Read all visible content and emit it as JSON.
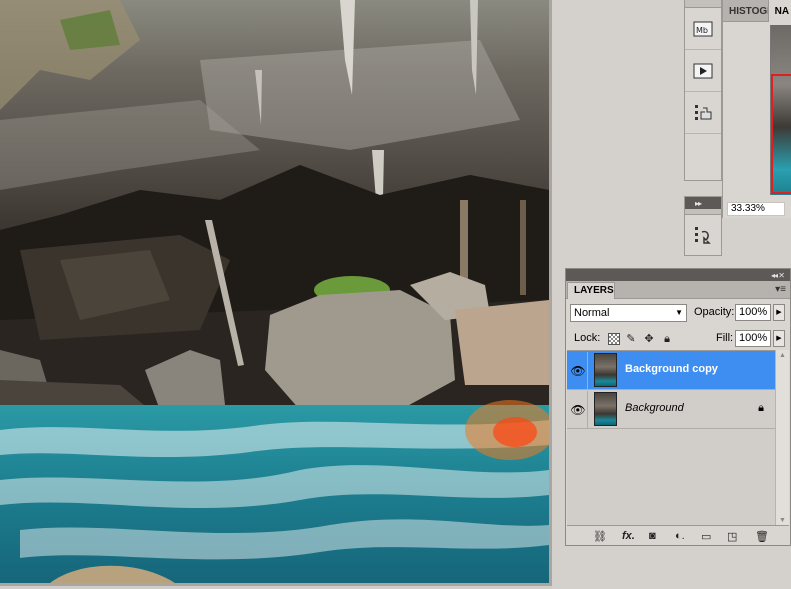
{
  "navigator": {
    "tab_histogram": "HISTOGR",
    "tab_navigator": "NA",
    "zoom": "33.33%"
  },
  "icon_strip": {
    "top_icons": [
      "mini-bridge-icon",
      "play-actions-icon",
      "clone-source-icon"
    ],
    "bottom_icons": [
      "history-icon"
    ]
  },
  "layers": {
    "tab_label": "LAYERS",
    "blend_mode": "Normal",
    "opacity_label": "Opacity:",
    "opacity_value": "100%",
    "lock_label": "Lock:",
    "fill_label": "Fill:",
    "fill_value": "100%",
    "items": [
      {
        "name": "Background copy",
        "selected": true,
        "locked": false
      },
      {
        "name": "Background",
        "selected": false,
        "locked": true
      }
    ]
  },
  "colors": {
    "selection": "#3e8ef1",
    "panel_bg": "#d9d6d2",
    "dock_bg": "#d4d0cb"
  }
}
